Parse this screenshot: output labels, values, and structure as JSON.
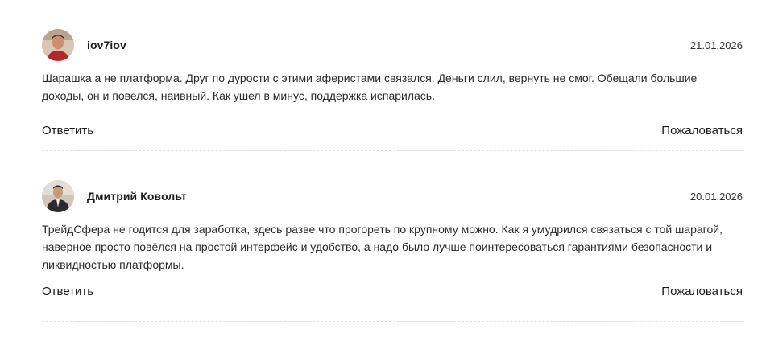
{
  "comments": [
    {
      "author": "iov7iov",
      "date": "21.01.2026",
      "text": "Шарашка а не платформа. Друг по дурости с этими аферистами связался. Деньги слил, вернуть не смог. Обещали большие доходы, он и повелся, наивный. Как ушел в минус, поддержка испарилась.",
      "reply_label": "Ответить",
      "report_label": "Пожаловаться"
    },
    {
      "author": "Дмитрий Ковольт",
      "date": "20.01.2026",
      "text": "ТрейдСфера не годится для заработка, здесь разве что прогореть по крупному можно. Как я умудрился связаться с той шарагой, наверное просто повёлся на простой интерфейс и удобство, а надо было лучше поинтересоваться гарантиями безопасности и ликвидностью платформы.",
      "reply_label": "Ответить",
      "report_label": "Пожаловаться"
    }
  ]
}
